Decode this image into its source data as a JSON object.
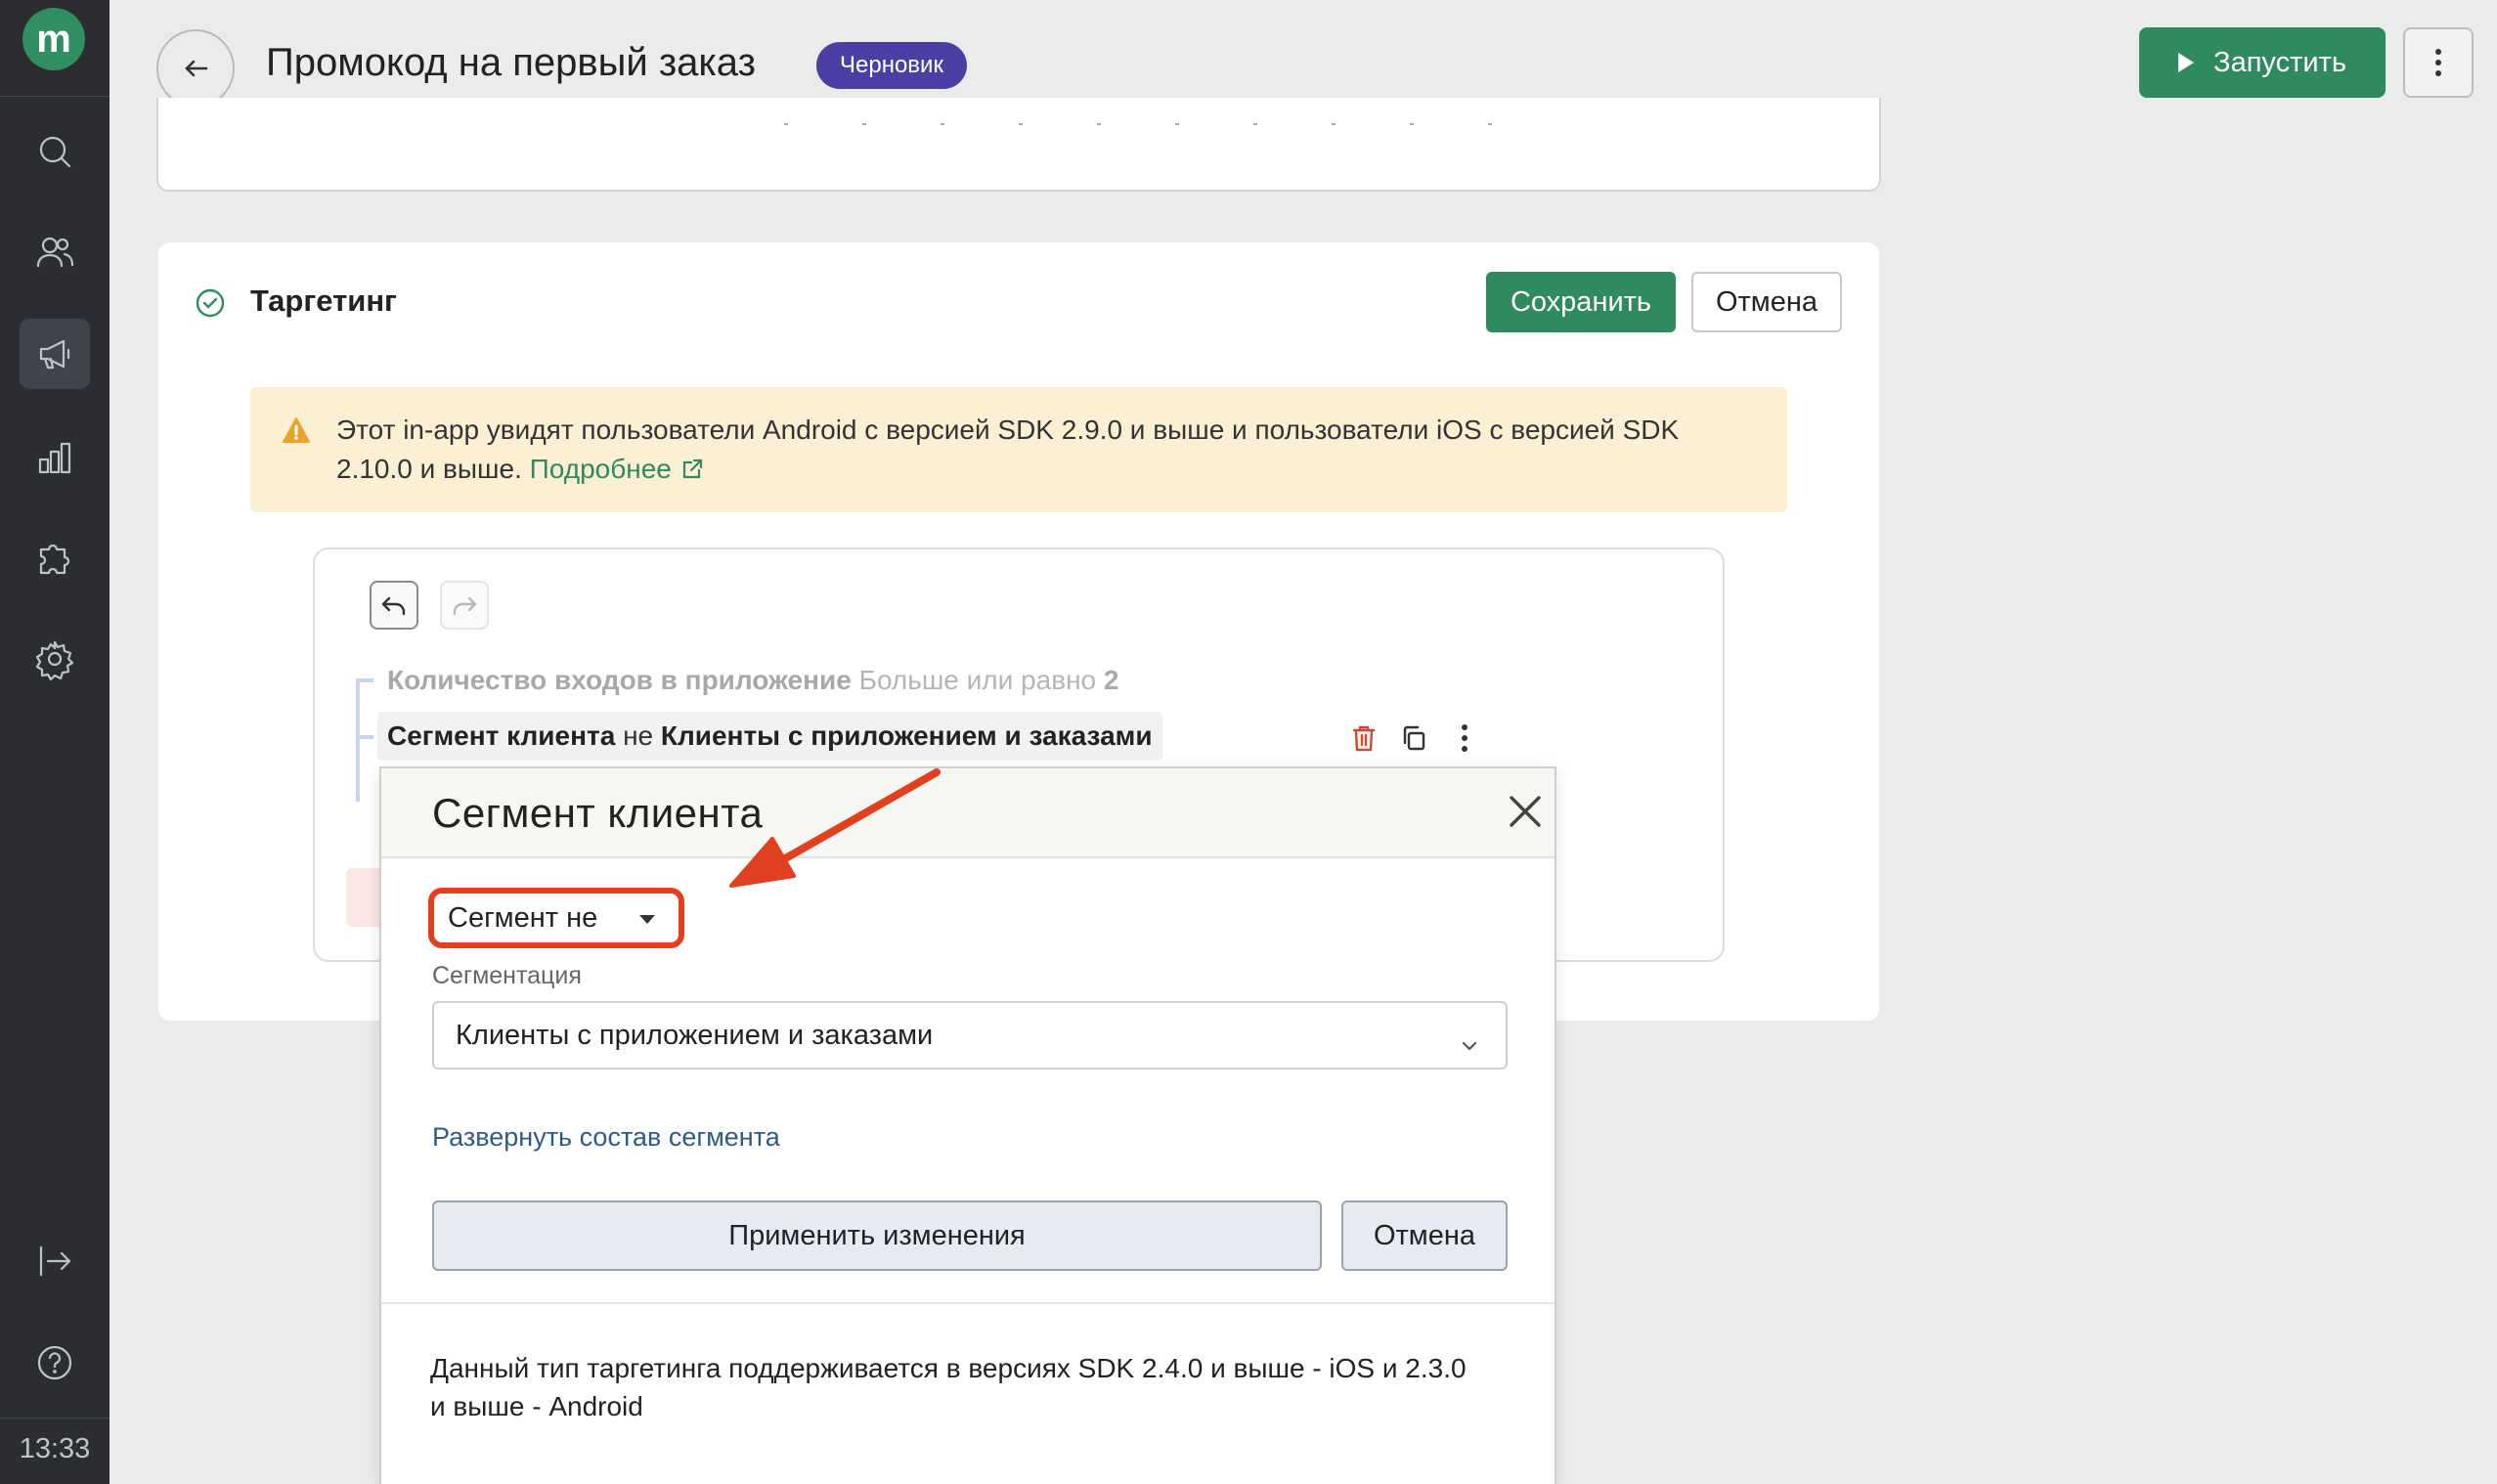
{
  "sidebar": {
    "logo_letter": "m",
    "items": [
      {
        "name": "search-icon"
      },
      {
        "name": "users-icon"
      },
      {
        "name": "megaphone-icon",
        "active": true
      },
      {
        "name": "chart-icon"
      },
      {
        "name": "puzzle-icon"
      },
      {
        "name": "gear-icon"
      },
      {
        "name": "logout-icon"
      },
      {
        "name": "help-icon"
      }
    ],
    "time": "13:33"
  },
  "header": {
    "title": "Промокод на первый заказ",
    "status": "Черновик",
    "launch_label": "Запустить"
  },
  "targeting": {
    "title": "Таргетинг",
    "save_label": "Сохранить",
    "cancel_label": "Отмена",
    "warning": {
      "text": "Этот in-app увидят пользователи Android с версией SDK 2.9.0 и выше и пользователи iOS с версией SDK 2.10.0 и выше.",
      "link": "Подробнее"
    },
    "conditions": [
      {
        "field": "Количество входов в приложение",
        "operator": "Больше или равно",
        "value": "2"
      },
      {
        "field": "Сегмент клиента",
        "operator": "не",
        "value": "Клиенты с приложением и заказами"
      }
    ]
  },
  "popup": {
    "title": "Сегмент клиента",
    "operator_value": "Сегмент не",
    "segmentation_label": "Сегментация",
    "segmentation_value": "Клиенты с приложением и заказами",
    "expand_link": "Развернуть состав сегмента",
    "apply_label": "Применить изменения",
    "cancel_label": "Отмена",
    "note": "Данный тип таргетинга поддерживается в версиях SDK 2.4.0 и выше - iOS и 2.3.0 и выше - Android"
  },
  "colors": {
    "primary_green": "#2f8a5e",
    "badge_purple": "#4b3fa3",
    "annotation_red": "#e0401f",
    "warning_bg": "#fcf0d4"
  }
}
